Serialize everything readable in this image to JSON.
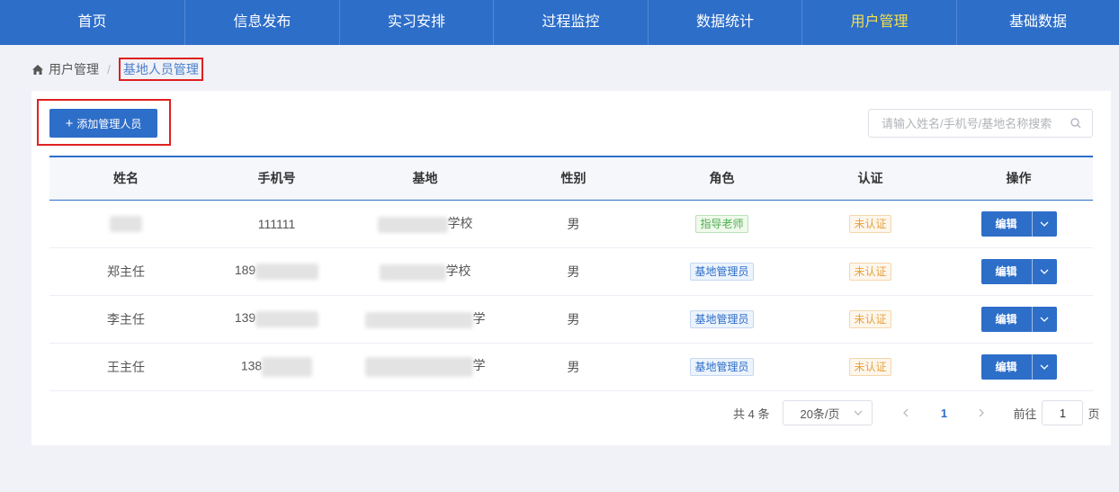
{
  "nav": {
    "items": [
      {
        "label": "首页"
      },
      {
        "label": "信息发布"
      },
      {
        "label": "实习安排"
      },
      {
        "label": "过程监控"
      },
      {
        "label": "数据统计"
      },
      {
        "label": "用户管理",
        "active": true
      },
      {
        "label": "基础数据"
      }
    ],
    "active_color": "#f7e04a",
    "bar_color": "#2d6ec9"
  },
  "breadcrumb": {
    "icon": "home-icon",
    "parent": "用户管理",
    "separator": "/",
    "current": "基地人员管理"
  },
  "toolbar": {
    "add_label": "添加管理人员",
    "search_placeholder": "请输入姓名/手机号/基地名称搜索"
  },
  "table": {
    "columns": [
      "姓名",
      "手机号",
      "基地",
      "性别",
      "角色",
      "认证",
      "操作"
    ],
    "rows": [
      {
        "name": "",
        "phone": "111111",
        "base": "学校",
        "gender": "男",
        "role": "指导老师",
        "role_style": "green",
        "auth": "未认证",
        "action": "编辑"
      },
      {
        "name": "郑主任",
        "phone": "189",
        "base": "学校",
        "gender": "男",
        "role": "基地管理员",
        "role_style": "blue",
        "auth": "未认证",
        "action": "编辑"
      },
      {
        "name": "李主任",
        "phone": "139",
        "base": "学",
        "gender": "男",
        "role": "基地管理员",
        "role_style": "blue",
        "auth": "未认证",
        "action": "编辑"
      },
      {
        "name": "王主任",
        "phone": "138",
        "base": "学",
        "gender": "男",
        "role": "基地管理员",
        "role_style": "blue",
        "auth": "未认证",
        "action": "编辑"
      }
    ]
  },
  "pagination": {
    "total": "共 4 条",
    "page_size": "20条/页",
    "current_page": "1",
    "goto_label": "前往",
    "goto_value": "1",
    "goto_suffix": "页"
  }
}
